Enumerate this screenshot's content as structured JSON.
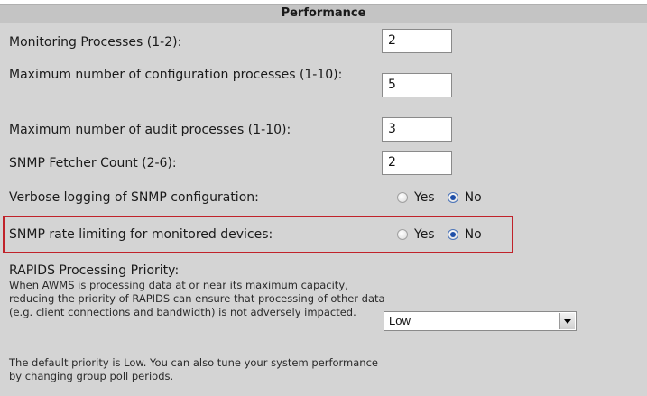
{
  "panel": {
    "title": "Performance"
  },
  "fields": [
    {
      "label": "Monitoring Processes (1-2):",
      "value": "2"
    },
    {
      "label": "Maximum number of configuration processes (1-10):",
      "value": "5"
    },
    {
      "label": "Maximum number of audit processes (1-10):",
      "value": "3"
    },
    {
      "label": "SNMP Fetcher Count (2-6):",
      "value": "2"
    }
  ],
  "verbose_logging": {
    "label": "Verbose logging of SNMP configuration:",
    "yes": "Yes",
    "no": "No",
    "selected": "No"
  },
  "rate_limiting": {
    "label": "SNMP rate limiting for monitored devices:",
    "yes": "Yes",
    "no": "No",
    "selected": "No"
  },
  "rapids": {
    "title": "RAPIDS Processing Priority:",
    "description": "When AWMS is processing data at or near its maximum capacity, reducing the priority of RAPIDS can ensure that processing of other data (e.g. client connections and bandwidth) is not adversely impacted.",
    "note": "The default priority is Low. You can also tune your system performance by changing group poll periods.",
    "selected": "Low"
  },
  "colors": {
    "panel_bg": "#d4d4d4",
    "header_bg": "#c4c4c4",
    "highlight": "#c0222a",
    "radio_selected": "#1f4fa8"
  }
}
